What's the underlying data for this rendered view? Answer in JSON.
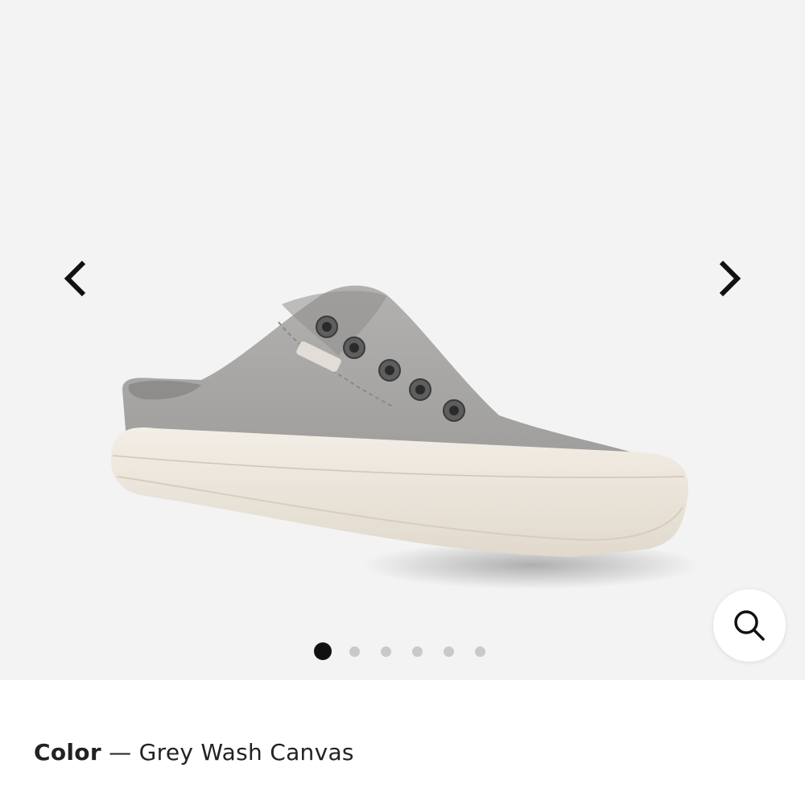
{
  "gallery": {
    "background_color": "#f3f3f3",
    "image_alt": "Grey Wash Canvas slip-on sneaker",
    "prev_icon": "chevron-left-icon",
    "next_icon": "chevron-right-icon",
    "zoom_icon": "search-icon",
    "slide_count": 6,
    "active_slide": 1
  },
  "product": {
    "color_label": "Color",
    "color_separator": " — ",
    "color_value": "Grey Wash Canvas"
  },
  "colors": {
    "canvas": "#a3a2a0",
    "sole": "#ece6dc",
    "text": "#222222",
    "dot_active": "#111111",
    "dot_inactive": "#c9c9c9"
  }
}
